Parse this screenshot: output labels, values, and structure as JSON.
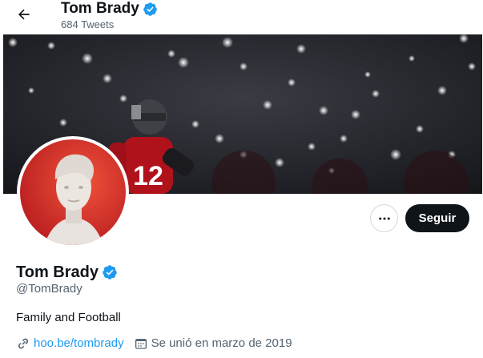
{
  "header": {
    "title": "Tom Brady",
    "tweet_count": "684 Tweets"
  },
  "banner": {
    "jersey_number": "12"
  },
  "profile": {
    "name": "Tom Brady",
    "handle": "@TomBrady",
    "bio": "Family and Football",
    "website": "hoo.be/tombrady",
    "joined": "Se unió en marzo de 2019",
    "verified_color": "#1d9bf0"
  },
  "actions": {
    "follow_label": "Seguir",
    "more_icon": "more-horizontal-icon"
  },
  "icons": {
    "back": "arrow-left-icon",
    "link": "link-icon",
    "calendar": "calendar-icon",
    "verified": "verified-badge-icon"
  }
}
